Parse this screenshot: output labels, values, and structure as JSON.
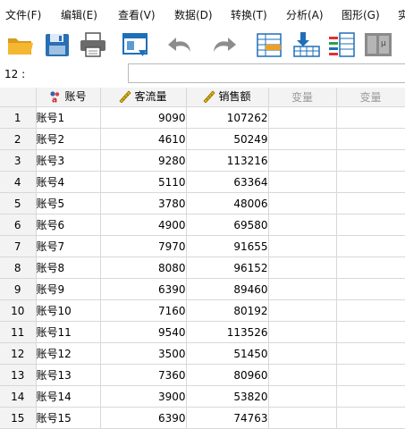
{
  "menu": [
    "文件(F)",
    "编辑(E)",
    "查看(V)",
    "数据(D)",
    "转换(T)",
    "分析(A)",
    "图形(G)",
    "实"
  ],
  "toolbar": {
    "icons": [
      "open-folder-icon",
      "save-icon",
      "print-icon",
      "recall-dialog-icon",
      "undo-icon",
      "redo-icon",
      "goto-case-icon",
      "goto-variable-icon",
      "variables-icon",
      "split-file-icon"
    ]
  },
  "cell_editor": {
    "ref": "12 :",
    "value": ""
  },
  "grid": {
    "columns": [
      {
        "label": "账号",
        "icon": "string-var-icon"
      },
      {
        "label": "客流量",
        "icon": "ruler-icon"
      },
      {
        "label": "销售额",
        "icon": "ruler-icon"
      },
      {
        "label": "变量",
        "icon": ""
      },
      {
        "label": "变量",
        "icon": ""
      }
    ],
    "rows": [
      {
        "n": "1",
        "acct": "账号1",
        "traffic": "9090",
        "sales": "107262"
      },
      {
        "n": "2",
        "acct": "账号2",
        "traffic": "4610",
        "sales": "50249"
      },
      {
        "n": "3",
        "acct": "账号3",
        "traffic": "9280",
        "sales": "113216"
      },
      {
        "n": "4",
        "acct": "账号4",
        "traffic": "5110",
        "sales": "63364"
      },
      {
        "n": "5",
        "acct": "账号5",
        "traffic": "3780",
        "sales": "48006"
      },
      {
        "n": "6",
        "acct": "账号6",
        "traffic": "4900",
        "sales": "69580"
      },
      {
        "n": "7",
        "acct": "账号7",
        "traffic": "7970",
        "sales": "91655"
      },
      {
        "n": "8",
        "acct": "账号8",
        "traffic": "8080",
        "sales": "96152"
      },
      {
        "n": "9",
        "acct": "账号9",
        "traffic": "6390",
        "sales": "89460"
      },
      {
        "n": "10",
        "acct": "账号10",
        "traffic": "7160",
        "sales": "80192"
      },
      {
        "n": "11",
        "acct": "账号11",
        "traffic": "9540",
        "sales": "113526"
      },
      {
        "n": "12",
        "acct": "账号12",
        "traffic": "3500",
        "sales": "51450"
      },
      {
        "n": "13",
        "acct": "账号13",
        "traffic": "7360",
        "sales": "80960"
      },
      {
        "n": "14",
        "acct": "账号14",
        "traffic": "3900",
        "sales": "53820"
      },
      {
        "n": "15",
        "acct": "账号15",
        "traffic": "6390",
        "sales": "74763"
      }
    ]
  },
  "colors": {
    "header_bg": "#f3f3f3",
    "grid_line": "#d8d8d8",
    "toolbar_blue": "#1e6fb8"
  }
}
